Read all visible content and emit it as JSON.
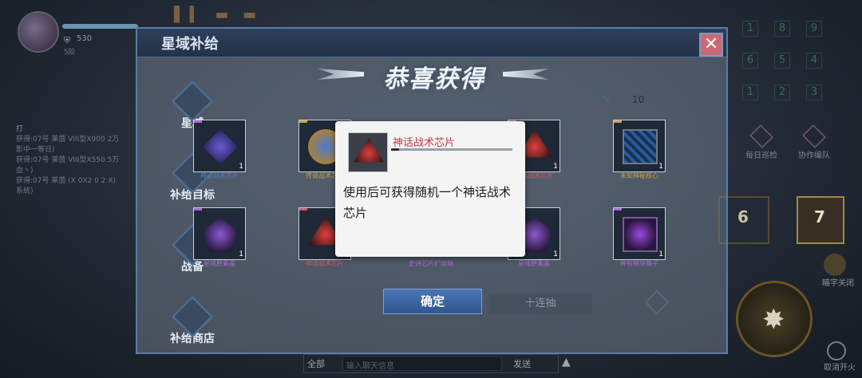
{
  "hud": {
    "value": "530",
    "sub_label": "5阶",
    "chat_head": "打",
    "chat_lines": [
      "获得:07号 莱茵 VIII型X900 2万",
      "影中一等日)",
      "获得:07号 莱茵 VIII型X550 5万",
      "血丶)",
      "获得:07号 莱茵 (X 0X2 0 2 X)",
      "系统)"
    ],
    "grid_numbers": [
      "1",
      "8",
      "9",
      "6",
      "5",
      "4",
      "1",
      "2",
      "3"
    ],
    "daily_patrol": "每日巡检",
    "co_op": "协作编队",
    "slot_six": "6",
    "slot_seven": "7",
    "auto_label": "瞄字关闭",
    "cancel_label": "取消开火",
    "chat_all": "全部",
    "chat_placeholder": "输入聊天信息",
    "chat_send": "发送"
  },
  "panel": {
    "title": "星域补给",
    "banner": "恭喜获得",
    "count": "10",
    "side_tabs": [
      "星域",
      "补给目标",
      "战备",
      "补给商店"
    ],
    "confirm_label": "确定",
    "second_label": "十连抽"
  },
  "items": [
    {
      "count": "1",
      "name": "神话战术芯片",
      "color": "blue"
    },
    {
      "count": "1",
      "name": "传说战术芯片",
      "color": "gold"
    },
    {
      "count": "1",
      "name": "神话战术芯片",
      "color": "red"
    },
    {
      "count": "1",
      "name": "未知神秘核心",
      "color": "gold"
    },
    {
      "count": "1",
      "name": "星域原素晶",
      "color": "purple"
    },
    {
      "count": "1",
      "name": "神话战术芯片",
      "color": "red"
    },
    {
      "count": "1",
      "name": "史诗芯片扩容箱",
      "color": "purple"
    },
    {
      "count": "1",
      "name": "星域原素晶",
      "color": "purple"
    },
    {
      "count": "1",
      "name": "稀有模块箱子",
      "color": "purple"
    }
  ],
  "tooltip": {
    "name": "神话战术芯片",
    "description": "使用后可获得随机一个神话战术芯片"
  },
  "colors": {
    "accent": "#4a74b4",
    "mythic": "#c23a4a"
  }
}
